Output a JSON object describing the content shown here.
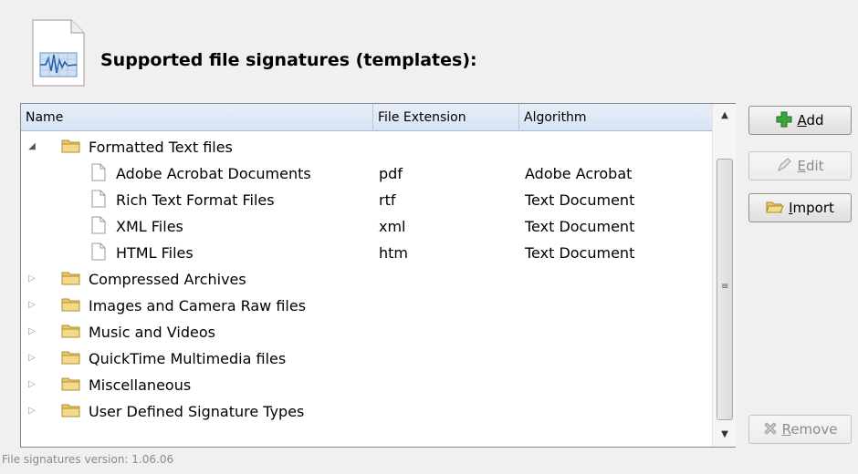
{
  "header": {
    "title": "Supported file signatures (templates):",
    "icon": "signature-document-icon"
  },
  "table": {
    "columns": [
      "Name",
      "File Extension",
      "Algorithm"
    ],
    "rows": [
      {
        "type": "folder",
        "label": "Formatted Text files",
        "expanded": true
      },
      {
        "type": "file",
        "label": "Adobe Acrobat Documents",
        "ext": "pdf",
        "alg": "Adobe Acrobat"
      },
      {
        "type": "file",
        "label": "Rich Text Format Files",
        "ext": "rtf",
        "alg": "Text Document"
      },
      {
        "type": "file",
        "label": "XML Files",
        "ext": "xml",
        "alg": "Text Document"
      },
      {
        "type": "file",
        "label": "HTML Files",
        "ext": "htm",
        "alg": "Text Document"
      },
      {
        "type": "folder",
        "label": "Compressed Archives",
        "expanded": false
      },
      {
        "type": "folder",
        "label": "Images and Camera Raw files",
        "expanded": false
      },
      {
        "type": "folder",
        "label": "Music and Videos",
        "expanded": false
      },
      {
        "type": "folder",
        "label": "QuickTime Multimedia files",
        "expanded": false
      },
      {
        "type": "folder",
        "label": "Miscellaneous",
        "expanded": false
      },
      {
        "type": "folder",
        "label": "User Defined Signature Types",
        "expanded": false
      }
    ]
  },
  "buttons": {
    "add": {
      "label": "Add",
      "accel": "A",
      "enabled": true,
      "icon": "green-plus-icon"
    },
    "edit": {
      "label": "Edit",
      "accel": "E",
      "enabled": false,
      "icon": "edit-pencil-icon"
    },
    "import": {
      "label": "Import",
      "accel": "I",
      "enabled": true,
      "icon": "folder-open-icon"
    },
    "remove": {
      "label": "Remove",
      "accel": "R",
      "enabled": false,
      "icon": "remove-x-icon"
    }
  },
  "footer": {
    "version_text": "File signatures version: 1.06.06"
  },
  "colors": {
    "header_bg": "#d7e3f4",
    "folder": "#e8c96a",
    "add_icon": "#3aa53a"
  }
}
